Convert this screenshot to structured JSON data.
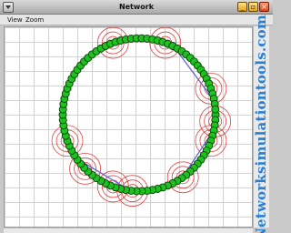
{
  "window": {
    "title": "Network"
  },
  "menu": {
    "items": [
      "View",
      "Zoom"
    ]
  },
  "watermark": "Networksimulationtools.com",
  "colors": {
    "node_fill": "#1ec21e",
    "node_stroke": "#0c3d0c",
    "range_circle": "#e02020",
    "link_line": "#5a5ae0",
    "ring_line": "#1f9a1f",
    "watermark": "#2b7fd2"
  },
  "scene": {
    "node_count": 90,
    "layout": "ring",
    "range_circles_at_degrees": [
      250,
      290,
      340,
      5,
      20,
      55,
      95,
      110,
      135,
      160
    ],
    "range_rings_per_circle": 3
  }
}
